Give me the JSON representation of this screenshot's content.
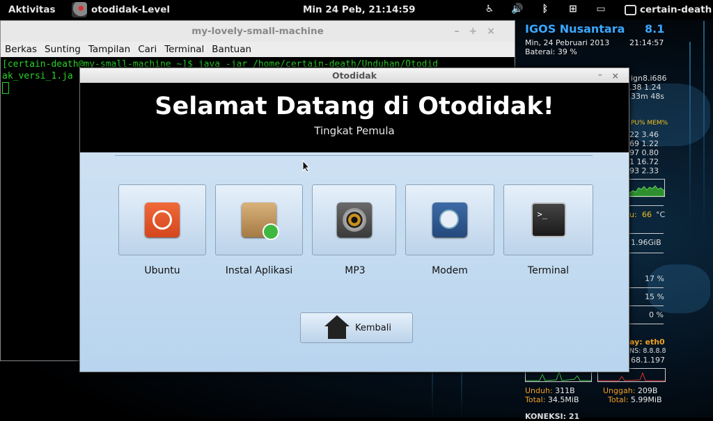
{
  "topbar": {
    "activities": "Aktivitas",
    "app_name": "otodidak-Level",
    "clock": "Min 24 Peb, 21:14:59",
    "user": "certain-death",
    "tray_icons": [
      "accessibility-icon",
      "volume-icon",
      "bluetooth-icon",
      "network-icon",
      "battery-icon"
    ]
  },
  "terminal": {
    "title": "my-lovely-small-machine",
    "controls": [
      "–",
      "+",
      "×"
    ],
    "menu": [
      "Berkas",
      "Sunting",
      "Tampilan",
      "Cari",
      "Terminal",
      "Bantuan"
    ],
    "line1": "[certain-death@my-small-machine ~]$ java -jar /home/certain-death/Unduhan/Otodid",
    "line2": "ak_versi_1.ja"
  },
  "conky": {
    "brand": "IGOS Nusantara",
    "version": "8.1",
    "date": "Min, 24 Pebruari 2013",
    "time": "21:14:57",
    "battery": "Baterai: 39 %",
    "frag_kernel": "ign8.i686",
    "frag_load": ".38 1.24",
    "frag_uptime": "33m 48s",
    "frag_cpumem": "PU% MEM%",
    "frag_proc": [
      "22  3.46",
      "69  1.22",
      "97  0.80",
      "1  16.72",
      "93  2.33"
    ],
    "frag_temp_label": "u:",
    "frag_temp": "66",
    "frag_temp_unit": "°C",
    "frag_mem": "1.96GiB",
    "frag_disk": [
      "17 %",
      "15 %",
      "0 %"
    ],
    "frag_gw": "ay: eth0",
    "frag_dns": "NS: 8.8.8.8",
    "frag_ip": "68.1.197",
    "down_label": "Unduh:",
    "down_value": "311B",
    "down_total_label": "Total:",
    "down_total": "34.5MiB",
    "up_label": "Unggah:",
    "up_value": "209B",
    "up_total_label": "Total:",
    "up_total": "5.99MiB",
    "koneksi": "KONEKSI: 21"
  },
  "dialog": {
    "title": "Otodidak",
    "min": "–",
    "close": "×",
    "heading": "Selamat Datang di Otodidak!",
    "subheading": "Tingkat Pemula",
    "tiles": [
      {
        "label": "Ubuntu",
        "icon": "ubuntu-icon"
      },
      {
        "label": "Instal Aplikasi",
        "icon": "package-install-icon"
      },
      {
        "label": "MP3",
        "icon": "speaker-icon"
      },
      {
        "label": "Modem",
        "icon": "modem-icon"
      },
      {
        "label": "Terminal",
        "icon": "terminal-icon"
      }
    ],
    "back_label": "Kembali"
  }
}
